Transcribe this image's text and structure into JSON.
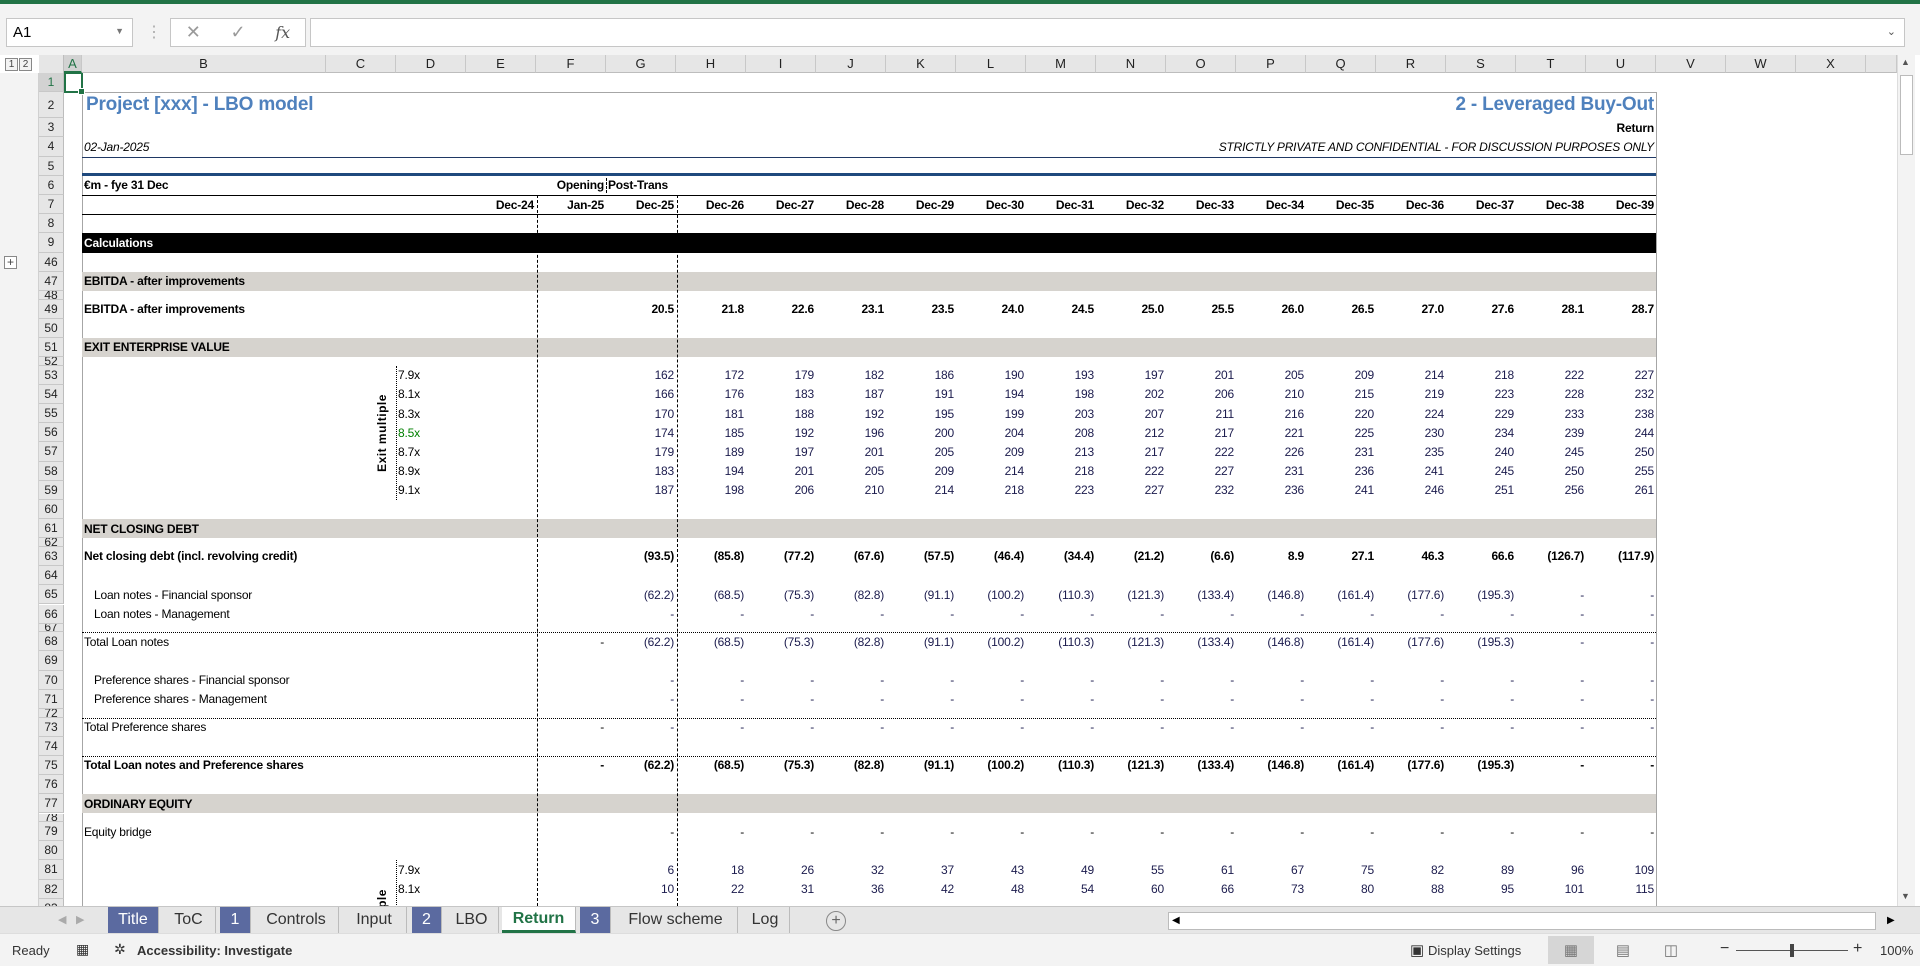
{
  "formula_bar": {
    "name_box": "A1",
    "formula": "",
    "cancel_icon": "✕",
    "enter_icon": "✓",
    "fx_label": "fx"
  },
  "outline_levels": [
    "1",
    "2"
  ],
  "columns": [
    "A",
    "B",
    "C",
    "D",
    "E",
    "F",
    "G",
    "H",
    "I",
    "J",
    "K",
    "L",
    "M",
    "N",
    "O",
    "P",
    "Q",
    "R",
    "S",
    "T",
    "U",
    "V",
    "W",
    "X"
  ],
  "sheet": {
    "title": "Project [xxx]  - LBO model",
    "section_title": "2 - Leveraged Buy-Out",
    "page_name": "Return",
    "date": "02-Jan-2025",
    "confidential": "STRICTLY PRIVATE AND CONFIDENTIAL - FOR DISCUSSION PURPOSES ONLY",
    "units": "€m - fye 31 Dec",
    "opening": "Opening",
    "post_trans": "Post-Trans",
    "periods": [
      "Dec-24",
      "Jan-25",
      "Dec-25",
      "Dec-26",
      "Dec-27",
      "Dec-28",
      "Dec-29",
      "Dec-30",
      "Dec-31",
      "Dec-32",
      "Dec-33",
      "Dec-34",
      "Dec-35",
      "Dec-36",
      "Dec-37",
      "Dec-38",
      "Dec-39"
    ],
    "sensitivity_label": "Exit multiple",
    "title_color": "#4f81bd",
    "section_fill": "#d6d3ce",
    "highlight_color": "#008000",
    "row_numbers": [
      "1",
      "2",
      "3",
      "4",
      "5",
      "6",
      "7",
      "8",
      "9",
      "46",
      "47",
      "48",
      "49",
      "50",
      "51",
      "52",
      "53",
      "54",
      "55",
      "56",
      "57",
      "58",
      "59",
      "60",
      "61",
      "62",
      "63",
      "64",
      "65",
      "66",
      "67",
      "68",
      "69",
      "70",
      "71",
      "72",
      "73",
      "74",
      "75",
      "76",
      "77",
      "78",
      "79",
      "80",
      "81",
      "82",
      "83"
    ],
    "rows": [
      {
        "n": "9",
        "kind": "black",
        "label": "Calculations"
      },
      {
        "n": "47",
        "kind": "section",
        "label": "EBITDA - after improvements"
      },
      {
        "n": "49",
        "kind": "bold",
        "label": "EBITDA - after improvements",
        "v": [
          "20.5",
          "21.8",
          "22.6",
          "23.1",
          "23.5",
          "24.0",
          "24.5",
          "25.0",
          "25.5",
          "26.0",
          "26.5",
          "27.0",
          "27.6",
          "28.1",
          "28.7"
        ]
      },
      {
        "n": "51",
        "kind": "section",
        "label": "EXIT ENTERPRISE VALUE"
      },
      {
        "n": "53",
        "kind": "mult",
        "label": "7.9x",
        "v": [
          "162",
          "172",
          "179",
          "182",
          "186",
          "190",
          "193",
          "197",
          "201",
          "205",
          "209",
          "214",
          "218",
          "222",
          "227"
        ]
      },
      {
        "n": "54",
        "kind": "mult",
        "label": "8.1x",
        "v": [
          "166",
          "176",
          "183",
          "187",
          "191",
          "194",
          "198",
          "202",
          "206",
          "210",
          "215",
          "219",
          "223",
          "228",
          "232"
        ]
      },
      {
        "n": "55",
        "kind": "mult",
        "label": "8.3x",
        "v": [
          "170",
          "181",
          "188",
          "192",
          "195",
          "199",
          "203",
          "207",
          "211",
          "216",
          "220",
          "224",
          "229",
          "233",
          "238"
        ]
      },
      {
        "n": "56",
        "kind": "mult",
        "label": "8.5x",
        "highlight": true,
        "v": [
          "174",
          "185",
          "192",
          "196",
          "200",
          "204",
          "208",
          "212",
          "217",
          "221",
          "225",
          "230",
          "234",
          "239",
          "244"
        ]
      },
      {
        "n": "57",
        "kind": "mult",
        "label": "8.7x",
        "v": [
          "179",
          "189",
          "197",
          "201",
          "205",
          "209",
          "213",
          "217",
          "222",
          "226",
          "231",
          "235",
          "240",
          "245",
          "250"
        ]
      },
      {
        "n": "58",
        "kind": "mult",
        "label": "8.9x",
        "v": [
          "183",
          "194",
          "201",
          "205",
          "209",
          "214",
          "218",
          "222",
          "227",
          "231",
          "236",
          "241",
          "245",
          "250",
          "255"
        ]
      },
      {
        "n": "59",
        "kind": "mult",
        "label": "9.1x",
        "v": [
          "187",
          "198",
          "206",
          "210",
          "214",
          "218",
          "223",
          "227",
          "232",
          "236",
          "241",
          "246",
          "251",
          "256",
          "261"
        ]
      },
      {
        "n": "61",
        "kind": "section",
        "label": "NET CLOSING DEBT"
      },
      {
        "n": "63",
        "kind": "bold",
        "label": "Net closing debt (incl. revolving credit)",
        "v": [
          "(93.5)",
          "(85.8)",
          "(77.2)",
          "(67.6)",
          "(57.5)",
          "(46.4)",
          "(34.4)",
          "(21.2)",
          "(6.6)",
          "8.9",
          "27.1",
          "46.3",
          "66.6",
          "(126.7)",
          "(117.9)"
        ]
      },
      {
        "n": "65",
        "kind": "indent",
        "label": "Loan notes - Financial sponsor",
        "v": [
          "(62.2)",
          "(68.5)",
          "(75.3)",
          "(82.8)",
          "(91.1)",
          "(100.2)",
          "(110.3)",
          "(121.3)",
          "(133.4)",
          "(146.8)",
          "(161.4)",
          "(177.6)",
          "(195.3)",
          "-",
          "-"
        ]
      },
      {
        "n": "66",
        "kind": "indent",
        "label": "Loan notes - Management",
        "v": [
          "-",
          "-",
          "-",
          "-",
          "-",
          "-",
          "-",
          "-",
          "-",
          "-",
          "-",
          "-",
          "-",
          "-",
          "-"
        ]
      },
      {
        "n": "68",
        "kind": "total",
        "label": "Total Loan notes",
        "f": "-",
        "v": [
          "(62.2)",
          "(68.5)",
          "(75.3)",
          "(82.8)",
          "(91.1)",
          "(100.2)",
          "(110.3)",
          "(121.3)",
          "(133.4)",
          "(146.8)",
          "(161.4)",
          "(177.6)",
          "(195.3)",
          "-",
          "-"
        ]
      },
      {
        "n": "70",
        "kind": "indent",
        "label": "Preference shares - Financial sponsor",
        "v": [
          "-",
          "-",
          "-",
          "-",
          "-",
          "-",
          "-",
          "-",
          "-",
          "-",
          "-",
          "-",
          "-",
          "-",
          "-"
        ]
      },
      {
        "n": "71",
        "kind": "indent",
        "label": "Preference shares - Management",
        "v": [
          "-",
          "-",
          "-",
          "-",
          "-",
          "-",
          "-",
          "-",
          "-",
          "-",
          "-",
          "-",
          "-",
          "-",
          "-"
        ]
      },
      {
        "n": "73",
        "kind": "total",
        "label": "Total Preference shares",
        "f": "-",
        "v": [
          "-",
          "-",
          "-",
          "-",
          "-",
          "-",
          "-",
          "-",
          "-",
          "-",
          "-",
          "-",
          "-",
          "-",
          "-"
        ]
      },
      {
        "n": "75",
        "kind": "totalbold",
        "label": "Total Loan notes and Preference shares",
        "f": "-",
        "v": [
          "(62.2)",
          "(68.5)",
          "(75.3)",
          "(82.8)",
          "(91.1)",
          "(100.2)",
          "(110.3)",
          "(121.3)",
          "(133.4)",
          "(146.8)",
          "(161.4)",
          "(177.6)",
          "(195.3)",
          "-",
          "-"
        ]
      },
      {
        "n": "77",
        "kind": "section",
        "label": "ORDINARY EQUITY"
      },
      {
        "n": "79",
        "kind": "plain",
        "label": "Equity bridge",
        "v": [
          "-",
          "-",
          "-",
          "-",
          "-",
          "-",
          "-",
          "-",
          "-",
          "-",
          "-",
          "-",
          "-",
          "-",
          "-"
        ]
      },
      {
        "n": "81",
        "kind": "mult",
        "label": "7.9x",
        "v": [
          "6",
          "18",
          "26",
          "32",
          "37",
          "43",
          "49",
          "55",
          "61",
          "67",
          "75",
          "82",
          "89",
          "96",
          "109"
        ]
      },
      {
        "n": "82",
        "kind": "mult",
        "label": "8.1x",
        "v": [
          "10",
          "22",
          "31",
          "36",
          "42",
          "48",
          "54",
          "60",
          "66",
          "73",
          "80",
          "88",
          "95",
          "101",
          "115"
        ]
      }
    ]
  },
  "tabs": [
    {
      "label": "Title",
      "style": "color"
    },
    {
      "label": "ToC",
      "style": "plain"
    },
    {
      "label": "1",
      "style": "num"
    },
    {
      "label": "Controls",
      "style": "plain"
    },
    {
      "label": "Input",
      "style": "plain"
    },
    {
      "label": "2",
      "style": "num"
    },
    {
      "label": "LBO",
      "style": "plain"
    },
    {
      "label": "Return",
      "style": "active"
    },
    {
      "label": "3",
      "style": "num"
    },
    {
      "label": "Flow scheme",
      "style": "plain"
    },
    {
      "label": "Log",
      "style": "plain"
    }
  ],
  "status": {
    "ready": "Ready",
    "accessibility": "Accessibility: Investigate",
    "display_settings": "Display Settings",
    "zoom_minus": "−",
    "zoom_plus": "+",
    "zoom": "100%",
    "zoom_percent": 100
  }
}
